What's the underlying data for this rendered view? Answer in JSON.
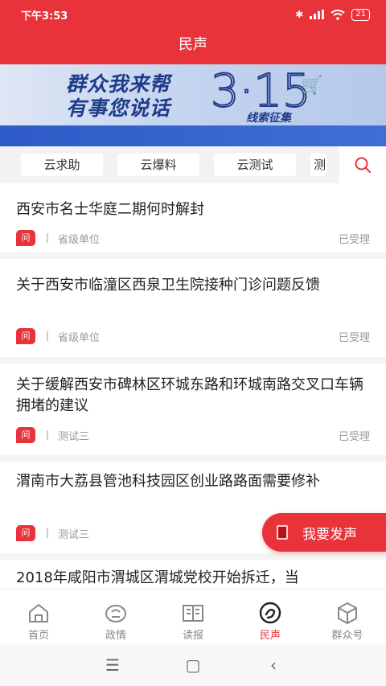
{
  "status": {
    "time": "下午3:53",
    "battery": "21"
  },
  "header": {
    "title": "民声"
  },
  "banner": {
    "line1": "群众我来帮",
    "line2": "有事您说话",
    "number": "3·15",
    "tag": "线索征集"
  },
  "tabs": [
    {
      "label": "云求助"
    },
    {
      "label": "云爆料"
    },
    {
      "label": "云测试"
    },
    {
      "label": "测"
    }
  ],
  "items": [
    {
      "title": "西安市名士华庭二期何时解封",
      "badge": "问",
      "dept": "省级单位",
      "status": "已受理"
    },
    {
      "title": "关于西安市临潼区西泉卫生院接种门诊问题反馈",
      "badge": "问",
      "dept": "省级单位",
      "status": "已受理"
    },
    {
      "title": "关于缓解西安市碑林区环城东路和环城南路交叉口车辆拥堵的建议",
      "badge": "问",
      "dept": "测试三",
      "status": "已受理"
    },
    {
      "title": "渭南市大荔县管池科技园区创业路路面需要修补",
      "badge": "问",
      "dept": "测试三",
      "status": ""
    },
    {
      "title": "2018年咸阳市渭城区渭城党校开始拆迁，当"
    }
  ],
  "fab": {
    "label": "我要发声"
  },
  "nav": [
    {
      "label": "首页"
    },
    {
      "label": "政情"
    },
    {
      "label": "读报"
    },
    {
      "label": "民声"
    },
    {
      "label": "群众号"
    }
  ],
  "colors": {
    "accent": "#e8333b"
  }
}
